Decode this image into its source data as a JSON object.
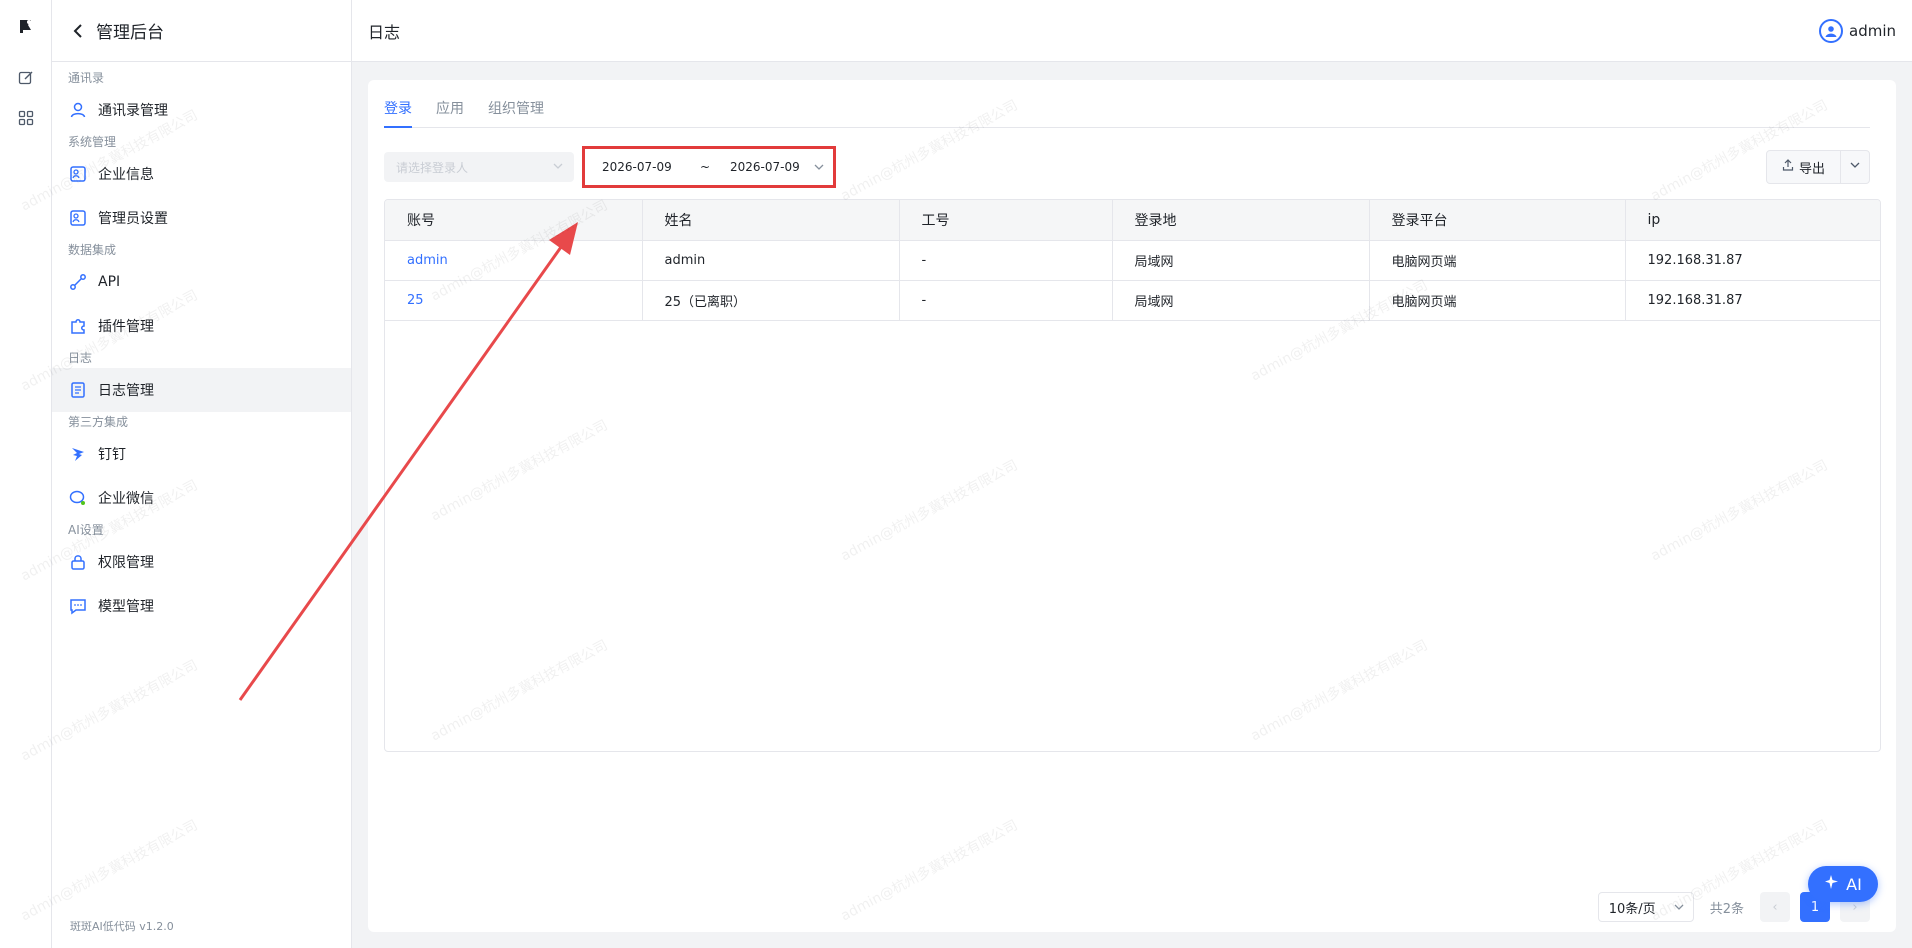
{
  "sidebar": {
    "title": "管理后台",
    "footer": "斑斑AI低代码 v1.2.0",
    "groups": [
      {
        "label": "通讯录",
        "items": [
          {
            "label": "通讯录管理",
            "icon": "user-icon"
          }
        ]
      },
      {
        "label": "系统管理",
        "items": [
          {
            "label": "企业信息",
            "icon": "building-icon"
          },
          {
            "label": "管理员设置",
            "icon": "admin-icon"
          }
        ]
      },
      {
        "label": "数据集成",
        "items": [
          {
            "label": "API",
            "icon": "api-icon"
          },
          {
            "label": "插件管理",
            "icon": "plugin-icon"
          }
        ]
      },
      {
        "label": "日志",
        "items": [
          {
            "label": "日志管理",
            "icon": "log-icon",
            "active": true
          }
        ]
      },
      {
        "label": "第三方集成",
        "items": [
          {
            "label": "钉钉",
            "icon": "dingtalk-icon"
          },
          {
            "label": "企业微信",
            "icon": "wecom-icon"
          }
        ]
      },
      {
        "label": "AI设置",
        "items": [
          {
            "label": "权限管理",
            "icon": "lock-icon"
          },
          {
            "label": "模型管理",
            "icon": "chat-icon"
          }
        ]
      }
    ]
  },
  "header": {
    "title": "日志",
    "user": "admin"
  },
  "tabs": [
    {
      "label": "登录",
      "active": true
    },
    {
      "label": "应用"
    },
    {
      "label": "组织管理"
    }
  ],
  "filters": {
    "user_placeholder": "请选择登录人",
    "date_start": "2026-07-09",
    "date_sep": "~",
    "date_end": "2026-07-09",
    "export_label": "导出"
  },
  "table": {
    "columns": [
      "账号",
      "姓名",
      "工号",
      "登录地",
      "登录平台",
      "ip"
    ],
    "rows": [
      [
        "admin",
        "admin",
        "-",
        "局域网",
        "电脑网页端",
        "192.168.31.87"
      ],
      [
        "25",
        "25（已离职）",
        "-",
        "局域网",
        "电脑网页端",
        "192.168.31.87"
      ]
    ]
  },
  "pager": {
    "page_size": "10条/页",
    "total": "共2条",
    "current": "1",
    "prev": "‹",
    "next": "›"
  },
  "ai_button": "AI",
  "watermark": "admin@杭州多冀科技有限公司",
  "colors": {
    "accent": "#3370ff",
    "highlight": "#e23b3b"
  }
}
